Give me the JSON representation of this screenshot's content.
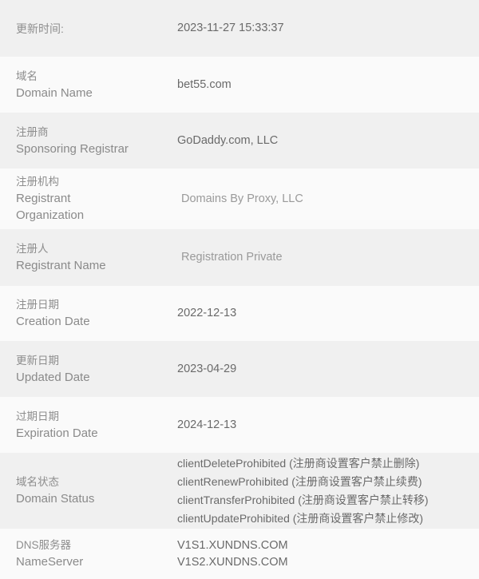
{
  "colors": {
    "stripe_dark": "#f0f0f0",
    "stripe_light": "#fafafa",
    "label_text": "#8a8a8a",
    "value_text": "#6a6a6a",
    "value_text_muted": "#9a9a9a"
  },
  "rows": [
    {
      "label_cn": "更新时间:",
      "label_en": "",
      "values": [
        "2023-11-27 15:33:37"
      ]
    },
    {
      "label_cn": "域名",
      "label_en": "Domain Name",
      "values": [
        "bet55.com"
      ]
    },
    {
      "label_cn": "注册商",
      "label_en": "Sponsoring Registrar",
      "values": [
        "GoDaddy.com, LLC"
      ]
    },
    {
      "label_cn": "注册机构",
      "label_en": "Registrant\nOrganization",
      "values": [
        "Domains By Proxy, LLC"
      ]
    },
    {
      "label_cn": "注册人",
      "label_en": "Registrant Name",
      "values": [
        "Registration Private"
      ]
    },
    {
      "label_cn": "注册日期",
      "label_en": "Creation Date",
      "values": [
        "2022-12-13"
      ]
    },
    {
      "label_cn": "更新日期",
      "label_en": "Updated Date",
      "values": [
        "2023-04-29"
      ]
    },
    {
      "label_cn": "过期日期",
      "label_en": "Expiration Date",
      "values": [
        "2024-12-13"
      ]
    },
    {
      "label_cn": "域名状态",
      "label_en": "Domain Status",
      "values": [
        "clientDeleteProhibited (注册商设置客户禁止删除)",
        "clientRenewProhibited (注册商设置客户禁止续费)",
        "clientTransferProhibited (注册商设置客户禁止转移)",
        "clientUpdateProhibited (注册商设置客户禁止修改)"
      ]
    },
    {
      "label_cn": "DNS服务器",
      "label_en": "NameServer",
      "values": [
        "V1S1.XUNDNS.COM",
        "V1S2.XUNDNS.COM"
      ]
    }
  ]
}
